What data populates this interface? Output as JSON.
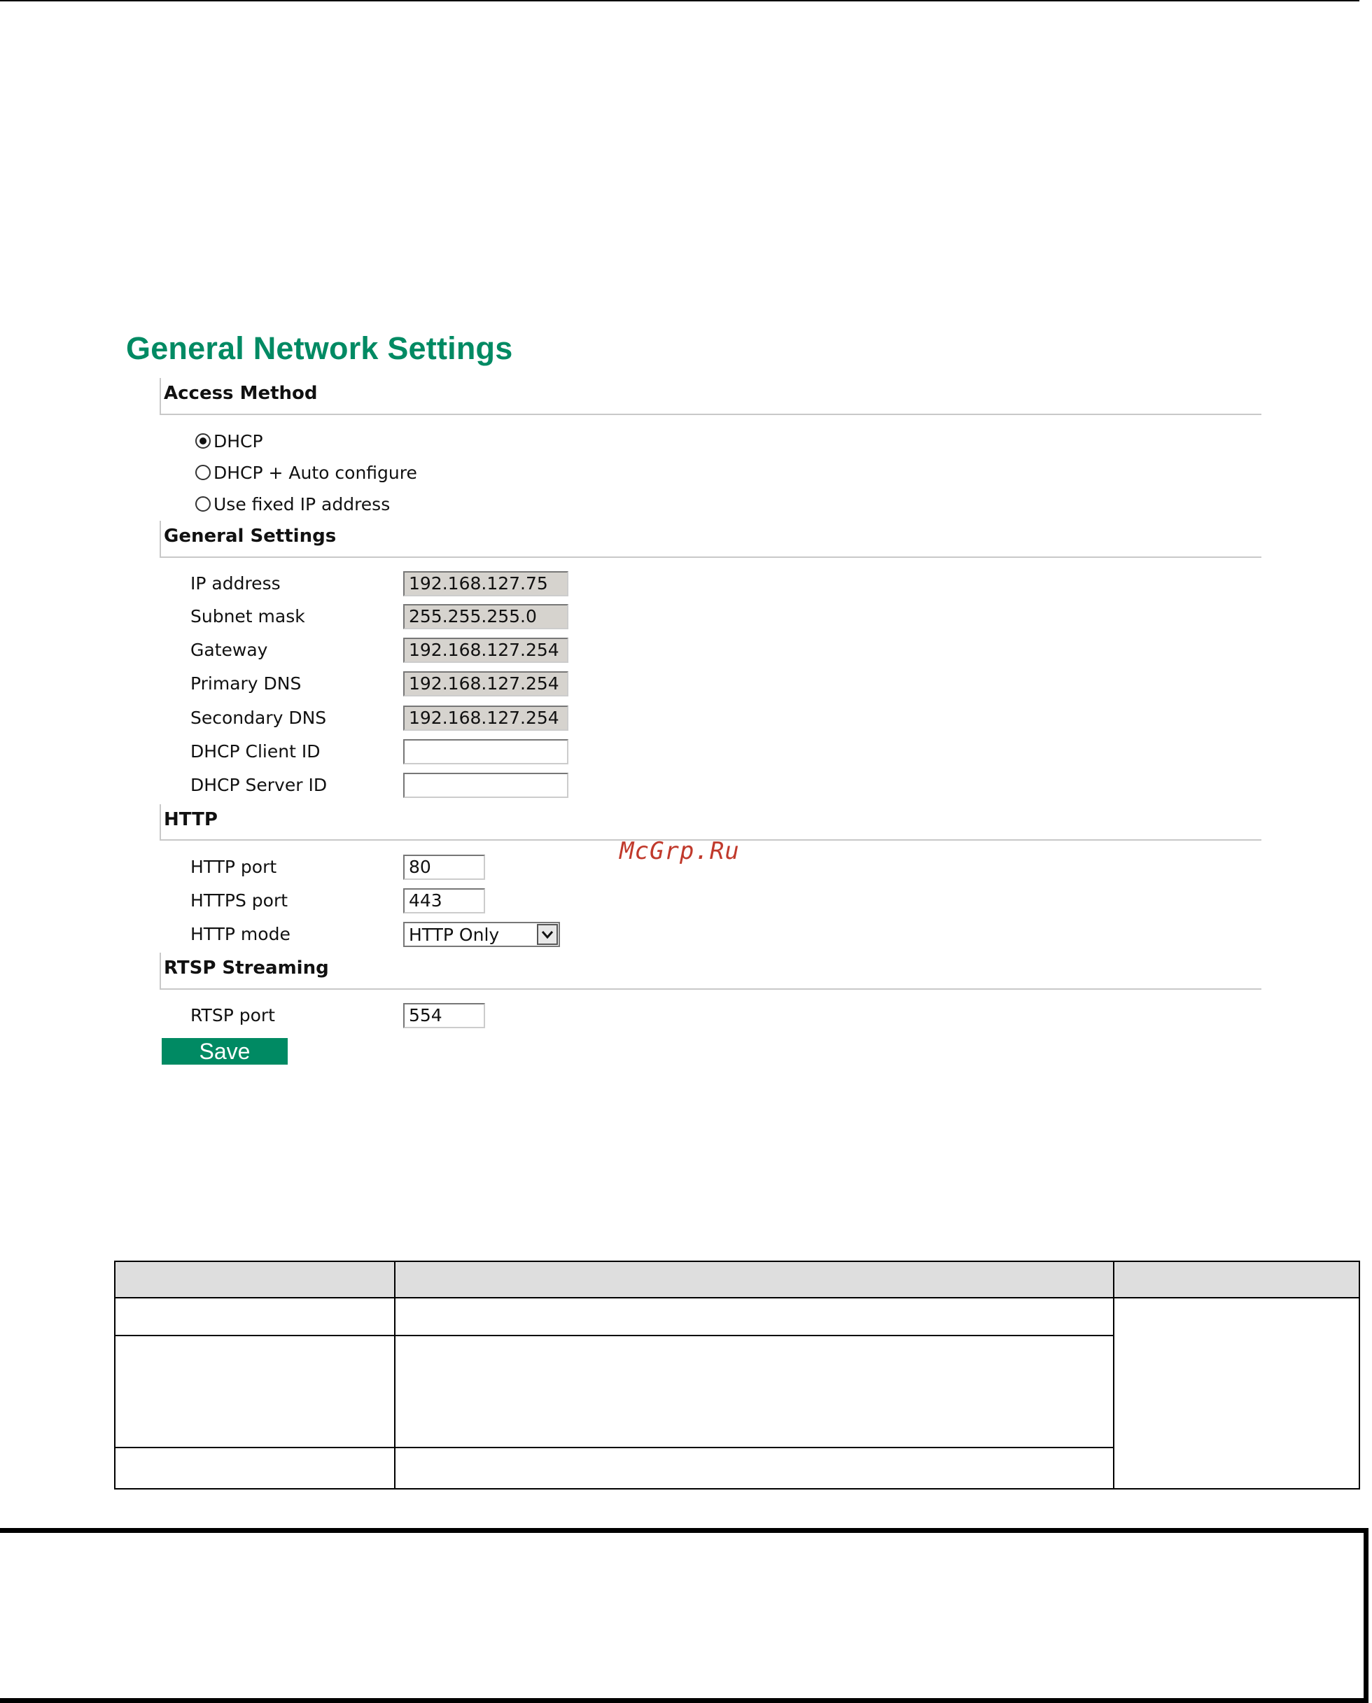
{
  "page": {
    "title": "General Network Settings"
  },
  "sections": {
    "access_method": "Access Method",
    "general_settings": "General Settings",
    "http": "HTTP",
    "rtsp": "RTSP Streaming"
  },
  "access_method": {
    "options": [
      {
        "label": "DHCP",
        "checked": true
      },
      {
        "label": "DHCP + Auto configure",
        "checked": false
      },
      {
        "label": "Use fixed IP address",
        "checked": false
      }
    ]
  },
  "general_settings": {
    "fields": [
      {
        "label": "IP address",
        "value": "192.168.127.75",
        "disabled": true
      },
      {
        "label": "Subnet mask",
        "value": "255.255.255.0",
        "disabled": true
      },
      {
        "label": "Gateway",
        "value": "192.168.127.254",
        "disabled": true
      },
      {
        "label": "Primary DNS",
        "value": "192.168.127.254",
        "disabled": true
      },
      {
        "label": "Secondary DNS",
        "value": "192.168.127.254",
        "disabled": true
      },
      {
        "label": "DHCP Client ID",
        "value": "",
        "disabled": false
      },
      {
        "label": "DHCP Server ID",
        "value": "",
        "disabled": false
      }
    ]
  },
  "http": {
    "http_port_label": "HTTP port",
    "http_port_value": "80",
    "https_port_label": "HTTPS port",
    "https_port_value": "443",
    "mode_label": "HTTP mode",
    "mode_value": "HTTP Only"
  },
  "rtsp": {
    "port_label": "RTSP port",
    "port_value": "554"
  },
  "actions": {
    "save_label": "Save"
  },
  "watermark": "McGrp.Ru",
  "colors": {
    "brand_green": "#008a63",
    "disabled_field": "#d6d3ce",
    "table_header": "#dedede",
    "watermark": "#c0392b"
  },
  "icons": {
    "select_arrow": "chevron-down-icon"
  }
}
